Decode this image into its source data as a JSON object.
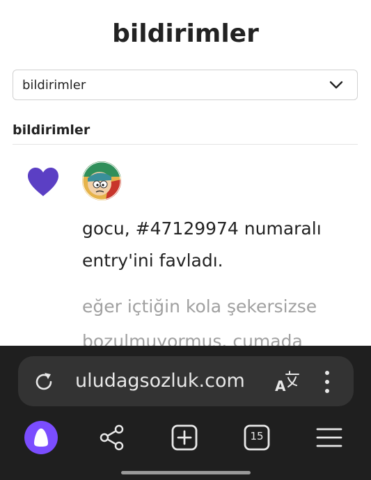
{
  "page": {
    "title": "bildirimler",
    "filter_select": {
      "value": "bildirimler"
    },
    "section_heading": "bildirimler"
  },
  "notification": {
    "icon": "heart-icon",
    "icon_color": "#5b3fc4",
    "text_line1": "gocu, #47129974 numaralı",
    "text_line2": "entry'ini favladı.",
    "preview_line1": "eğer içtiğin kola şekersizse",
    "preview_line2": "bozulmuyormuş. cumada"
  },
  "browser": {
    "url": "uludagsozluk.com",
    "tab_count": "15",
    "accent": "#7b4dff"
  }
}
